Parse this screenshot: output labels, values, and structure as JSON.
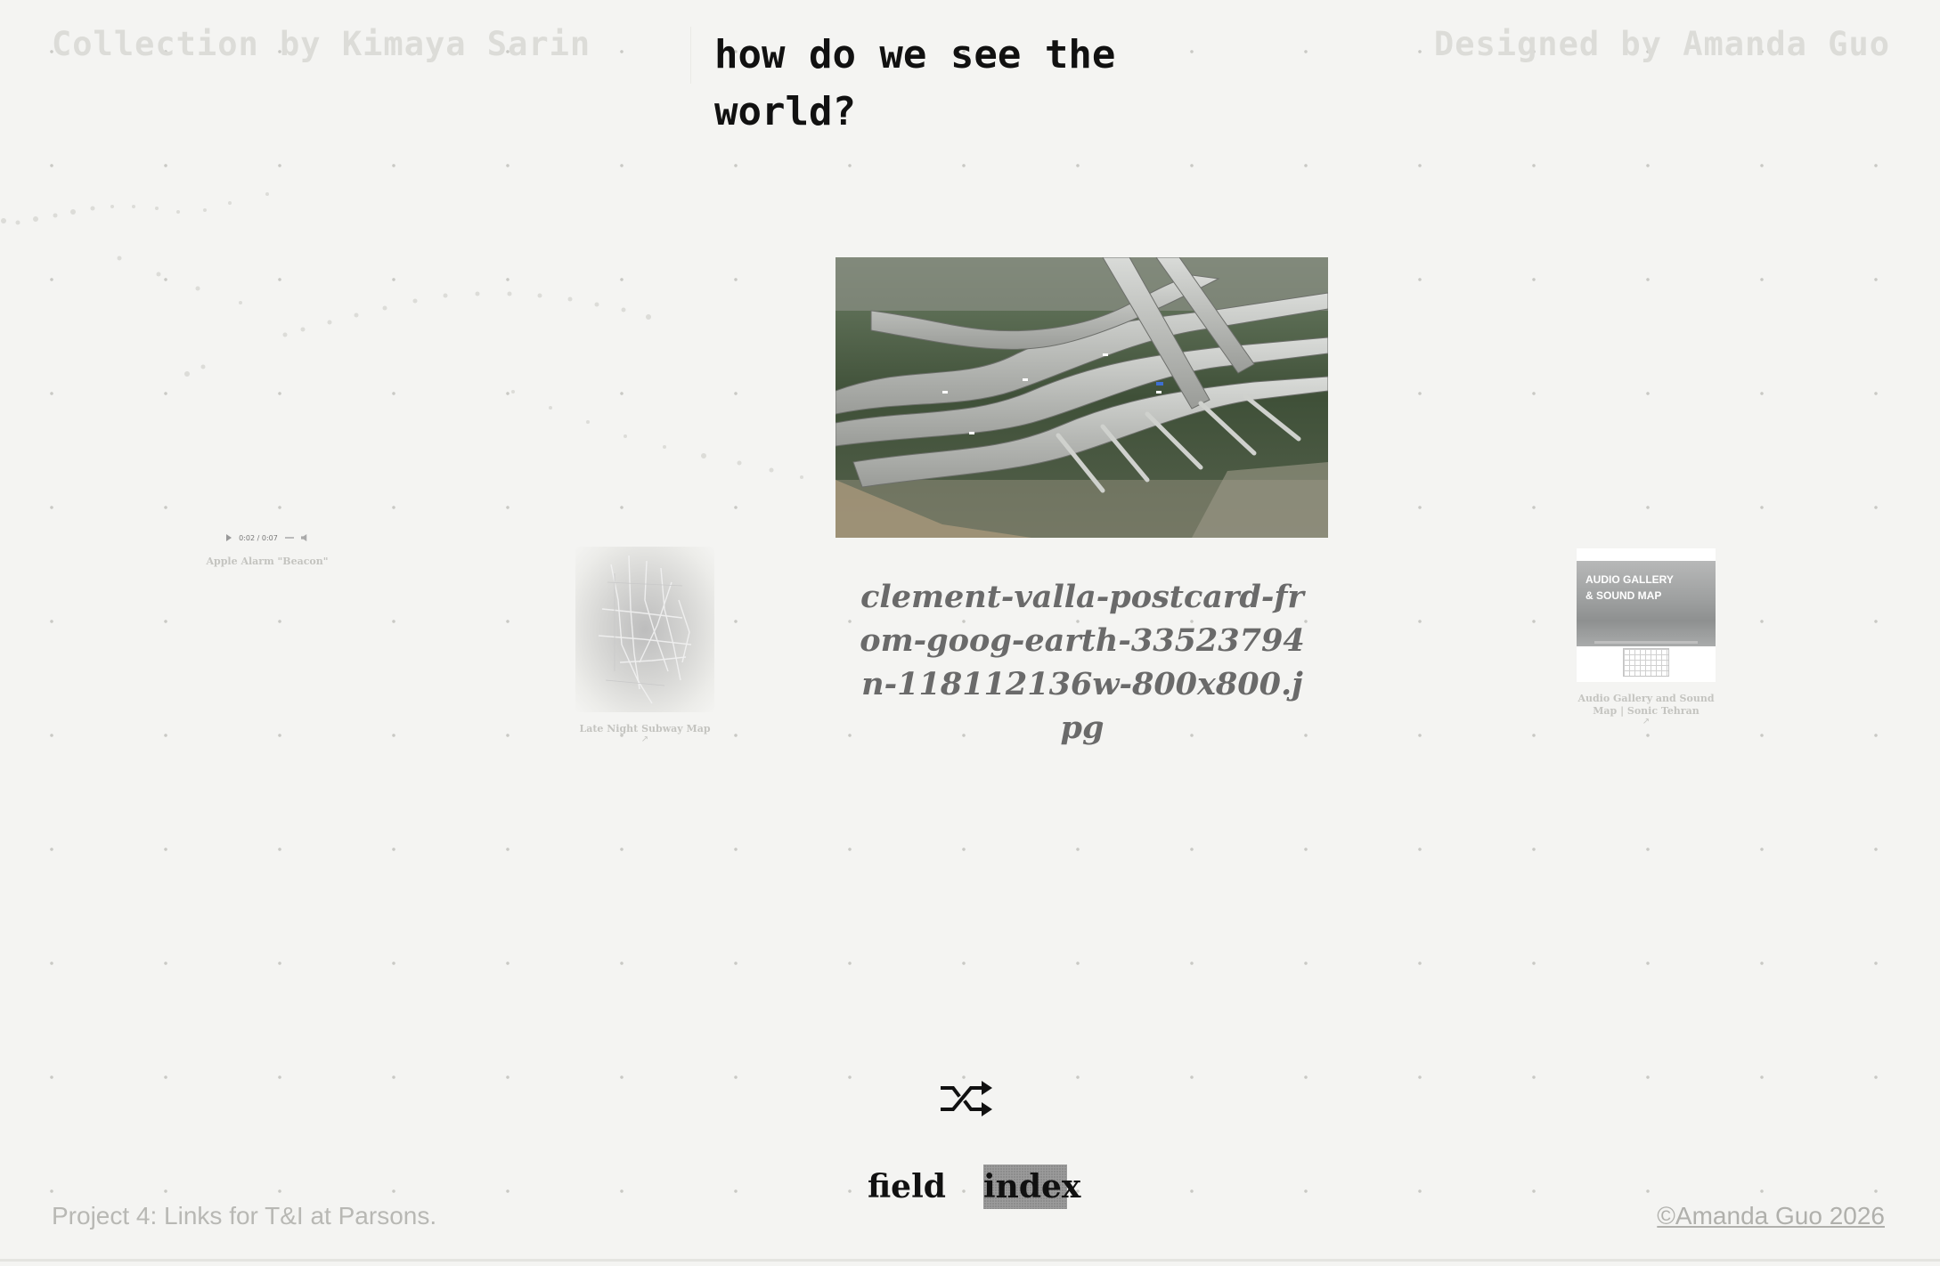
{
  "header": {
    "credit_left": "Collection by Kimaya Sarin",
    "title": "how do we see the world?",
    "credit_right": "Designed by Amanda Guo"
  },
  "items": {
    "audio": {
      "time": "0:02 / 0:07",
      "caption": "Apple Alarm \"Beacon\""
    },
    "subway": {
      "caption": "Late Night Subway Map",
      "arrow": "↗"
    },
    "soundmap": {
      "banner_title_line1": "AUDIO GALLERY",
      "banner_title_line2": "& SOUND MAP",
      "caption": "Audio Gallery and Sound Map | Sonic Tehran",
      "arrow": "↗"
    }
  },
  "featured": {
    "caption": "clement-valla-postcard-from-goog-earth-33523794n-118112136w-800x800.jpg"
  },
  "controls": {
    "field_label": "field",
    "index_label": "index"
  },
  "footer": {
    "left": "Project 4: Links for T&I at Parsons.",
    "right": "©Amanda Guo 2026"
  }
}
